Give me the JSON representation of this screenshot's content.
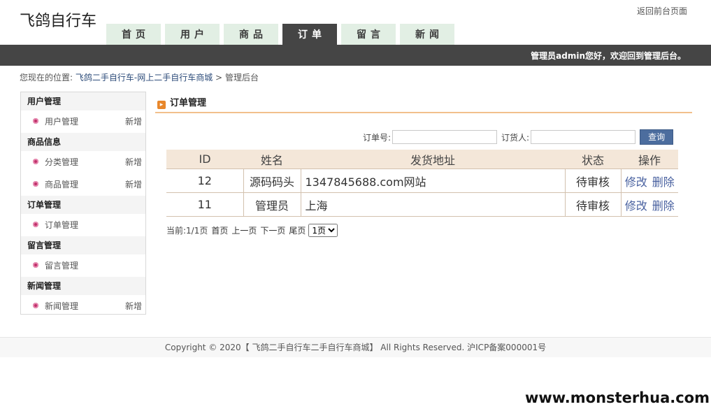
{
  "site": {
    "title": "飞鸽自行车",
    "back_link": "返回前台页面"
  },
  "nav": {
    "tabs": [
      "首页",
      "用户",
      "商品",
      "订单",
      "留言",
      "新闻"
    ],
    "active_index": 3
  },
  "welcome": "管理员admin您好，欢迎回到管理后台。",
  "breadcrumb": {
    "prefix": "您现在的位置:",
    "home": "飞鸽二手自行车-网上二手自行车商城",
    "sep": ">",
    "current": "管理后台"
  },
  "sidebar": {
    "groups": [
      {
        "title": "用户管理",
        "items": [
          {
            "label": "用户管理",
            "add": "新增"
          }
        ]
      },
      {
        "title": "商品信息",
        "items": [
          {
            "label": "分类管理",
            "add": "新增"
          },
          {
            "label": "商品管理",
            "add": "新增"
          }
        ]
      },
      {
        "title": "订单管理",
        "items": [
          {
            "label": "订单管理",
            "add": ""
          }
        ]
      },
      {
        "title": "留言管理",
        "items": [
          {
            "label": "留言管理",
            "add": ""
          }
        ]
      },
      {
        "title": "新闻管理",
        "items": [
          {
            "label": "新闻管理",
            "add": "新增"
          }
        ]
      }
    ]
  },
  "content": {
    "title": "订单管理"
  },
  "search": {
    "order_label": "订单号:",
    "order_value": "",
    "buyer_label": "订货人:",
    "buyer_value": "",
    "button": "查询"
  },
  "table": {
    "headers": [
      "ID",
      "姓名",
      "发货地址",
      "状态",
      "操作"
    ],
    "rows": [
      {
        "id": "12",
        "name": "源码码头",
        "address": "1347845688.com网站",
        "status": "待审核",
        "edit": "修改",
        "delete": "删除"
      },
      {
        "id": "11",
        "name": "管理员",
        "address": "上海",
        "status": "待审核",
        "edit": "修改",
        "delete": "删除"
      }
    ]
  },
  "pager": {
    "info": "当前:1/1页",
    "first": "首页",
    "prev": "上一页",
    "next": "下一页",
    "last": "尾页",
    "select_value": "1页"
  },
  "footer": "Copyright © 2020【 飞鸽二手自行车二手自行车商城】 All Rights Reserved. 沪ICP备案000001号",
  "watermark": "www.monsterhua.com",
  "colors": {
    "topbar": "#454545",
    "tab_bg": "#e2efe4",
    "title_underline": "#f2c08c",
    "table_header": "#f4e7d9",
    "search_button": "#4c6d9e",
    "bullet": "#c0306a"
  }
}
